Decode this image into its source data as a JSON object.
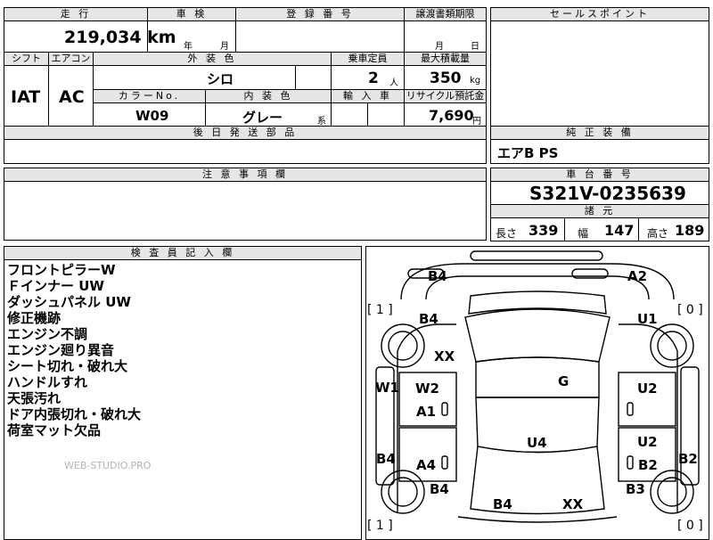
{
  "header": {
    "mileage_label": "走 行",
    "shaken_label": "車 検",
    "registration_label": "登 録 番 号",
    "transfer_label": "譲渡書類期限",
    "sales_point_label": "セールスポイント"
  },
  "mileage": {
    "value": "219,034",
    "unit": "km"
  },
  "shaken": {
    "year_unit": "年",
    "month_unit": "月"
  },
  "transfer": {
    "month_unit": "月",
    "day_unit": "日"
  },
  "row2": {
    "shift_label": "シフト",
    "aircon_label": "エアコン",
    "exterior_color_label": "外 装 色",
    "capacity_label": "乗車定員",
    "max_load_label": "最大積載量",
    "shift_value": "IAT",
    "aircon_value": "AC",
    "exterior_color_value": "シロ",
    "capacity_value": "2",
    "capacity_unit": "人",
    "max_load_value": "350",
    "max_load_unit": "kg",
    "color_no_label": "カラーNo.",
    "interior_color_label": "内 装 色",
    "import_label": "輸 入 車",
    "recycle_label": "リサイクル預託金",
    "color_no_value": "W09",
    "interior_color_value": "グレー",
    "interior_suffix": "系",
    "recycle_value": "7,690",
    "recycle_unit": "円"
  },
  "later_parts_label": "後 日 発 送 部 品",
  "genuine_equipment": {
    "label": "純 正 装 備",
    "value": "エアB PS"
  },
  "notes_label": "注 意 事 項 欄",
  "chassis": {
    "label": "車 台 番 号",
    "value": "S321V-0235639"
  },
  "specs": {
    "label": "諸 元",
    "length_label": "長さ",
    "length_value": "339",
    "width_label": "幅",
    "width_value": "147",
    "height_label": "高さ",
    "height_value": "189"
  },
  "inspector_label": "検 査 員 記 入 欄",
  "inspector_notes": [
    "フロントピラーW",
    "Ｆインナー UW",
    "ダッシュパネル UW",
    "修正機跡",
    "エンジン不調",
    "エンジン廻り異音",
    "シート切れ・破れ大",
    "ハンドルすれ",
    "天張汚れ",
    "ドア内張切れ・破れ大",
    "荷室マット欠品"
  ],
  "watermark": "WEB-STUDIO.PRO",
  "diagram": {
    "bracket_left_top": "[ 1 ]",
    "bracket_right_top": "[ 0 ]",
    "bracket_left_bottom": "[ 1 ]",
    "bracket_right_bottom": "[ 0 ]",
    "marks": [
      "B4",
      "A2",
      "B4",
      "U1",
      "XX",
      "W1",
      "W2",
      "G",
      "U2",
      "A1",
      "U4",
      "U2",
      "B4",
      "A4",
      "B2",
      "B2",
      "B4",
      "B3",
      "B4",
      "XX"
    ]
  }
}
